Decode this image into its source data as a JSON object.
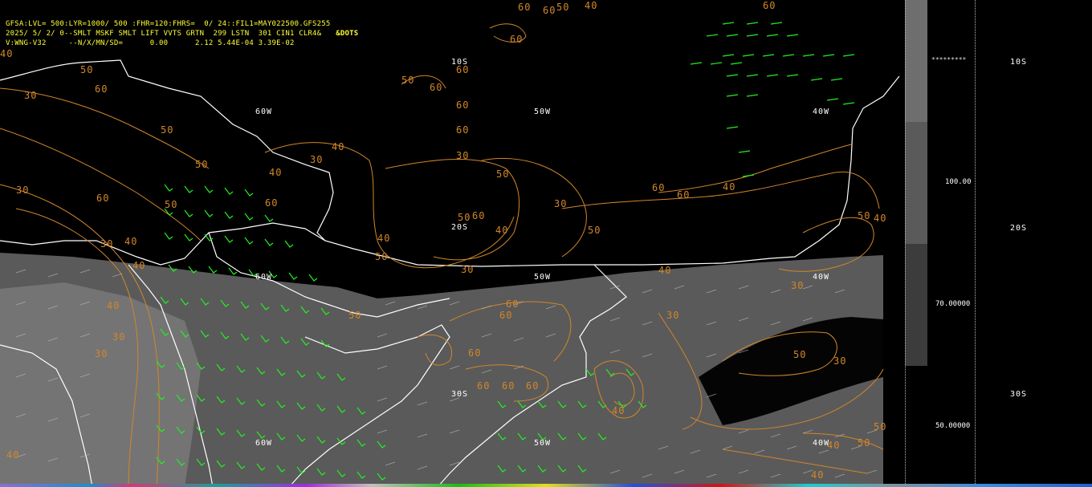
{
  "header": {
    "line1": "GFSA:LVL= 500:LYR=1000/ 500 :FHR=120:FHRS=  0/ 24::FIL1=MAY022500.GFS255",
    "line2": "2025/ 5/ 2/ 0--SMLT MSKF SMLT LIFT VVTS GRTN  299 LSTN  301 CIN1 CLR4&",
    "line2_tag": "&DOTS",
    "line3": "V:WNG-V32     --N/X/MN/SD=      0.00      2.12 5.44E-04 3.39E-02"
  },
  "map": {
    "lon_labels": [
      "60W",
      "50W",
      "40W"
    ],
    "lat_labels": [
      "10S",
      "20S",
      "30S"
    ],
    "contour_labels": [
      "60",
      "60",
      "50",
      "40",
      "60",
      "40",
      "60",
      "50",
      "60",
      "50",
      "60",
      "60",
      "60",
      "30",
      "60",
      "50",
      "50",
      "30",
      "40",
      "40",
      "30",
      "60",
      "50",
      "40",
      "50",
      "60",
      "30",
      "50",
      "30",
      "40",
      "60",
      "60",
      "40",
      "50",
      "30",
      "40",
      "60",
      "40",
      "50",
      "40",
      "30",
      "50",
      "40",
      "30",
      "50",
      "60",
      "30",
      "60",
      "50",
      "60",
      "60",
      "60",
      "30",
      "40",
      "60",
      "30",
      "40",
      "50",
      "40",
      "50",
      "30",
      "40",
      "40"
    ],
    "colors": {
      "background": "#000000",
      "shaded_region": "#5a5a5a",
      "shaded_light": "#8a8a8a",
      "contours": "#d2862a",
      "wind_barbs": "#22ee22",
      "coastline": "#ffffff",
      "header_text": "#ffff33"
    }
  },
  "colorbar": {
    "values": [
      "100.00",
      "70.00000",
      "50.00000"
    ],
    "colors": [
      "#6e6e6e",
      "#5a5a5a",
      "#3c3c3c"
    ],
    "stars": "*********"
  }
}
